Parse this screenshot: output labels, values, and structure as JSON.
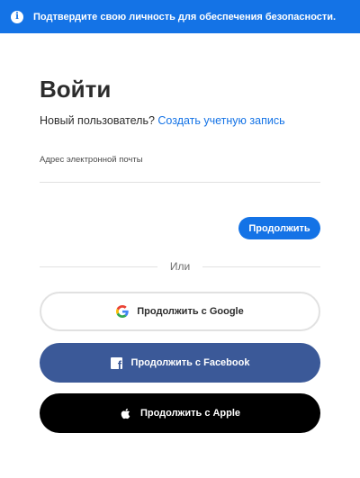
{
  "banner": {
    "icon": "info-icon",
    "text": "Подтвердите свою личность для обеспечения безопасности."
  },
  "signin": {
    "title": "Войти",
    "new_user_text": "Новый пользователь?",
    "create_account_link": "Создать учетную запись"
  },
  "email": {
    "label": "Адрес электронной почты",
    "value": "",
    "placeholder": ""
  },
  "continue_button": "Продолжить",
  "divider_text": "Или",
  "social": {
    "google": {
      "label": "Продолжить с Google",
      "icon": "google-icon"
    },
    "facebook": {
      "label": "Продолжить с Facebook",
      "icon": "facebook-icon"
    },
    "apple": {
      "label": "Продолжить с Apple",
      "icon": "apple-icon"
    }
  },
  "colors": {
    "accent": "#1473e6",
    "facebook": "#3b5998",
    "apple": "#000000"
  }
}
